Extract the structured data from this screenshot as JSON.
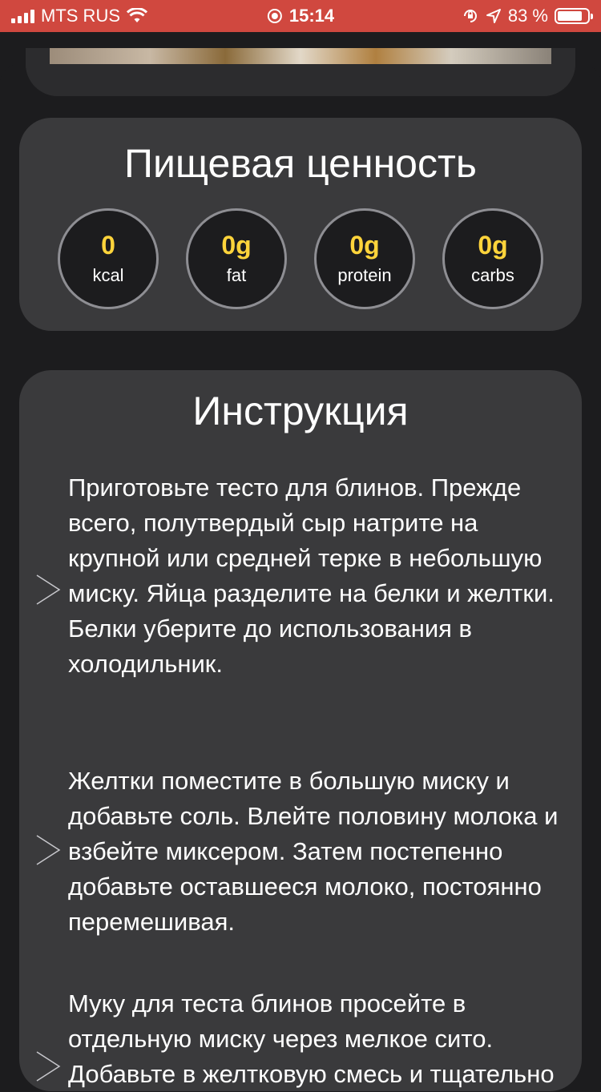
{
  "status_bar": {
    "carrier": "MTS RUS",
    "time": "15:14",
    "battery_percent": "83 %",
    "battery_level": 0.83
  },
  "nutrition": {
    "title": "Пищевая ценность",
    "items": [
      {
        "value": "0",
        "label": "kcal"
      },
      {
        "value": "0g",
        "label": "fat"
      },
      {
        "value": "0g",
        "label": "protein"
      },
      {
        "value": "0g",
        "label": "carbs"
      }
    ]
  },
  "instructions": {
    "title": "Инструкция",
    "steps": [
      "Приготовьте тесто для блинов. Прежде всего, полутвердый сыр натрите на крупной или средней терке в небольшую миску. Яйца разделите на белки и желтки. Белки уберите до использования в холодильник.",
      "Желтки поместите в большую миску и добавьте соль. Влейте половину молока и взбейте миксером. Затем постепенно добавьте оставшееся молоко, постоянно перемешивая.",
      "Муку для теста блинов просейте в отдельную миску через мелкое сито. Добавьте в желтковую смесь и тщательно"
    ]
  },
  "colors": {
    "status_bar": "#d0483f",
    "background": "#1c1c1e",
    "card": "#3a3a3c",
    "accent_value": "#ffd43b"
  },
  "icons": [
    "signal-icon",
    "wifi-icon",
    "recording-icon",
    "rotation-lock-icon",
    "location-arrow-icon",
    "battery-icon",
    "chevron-right-icon"
  ]
}
